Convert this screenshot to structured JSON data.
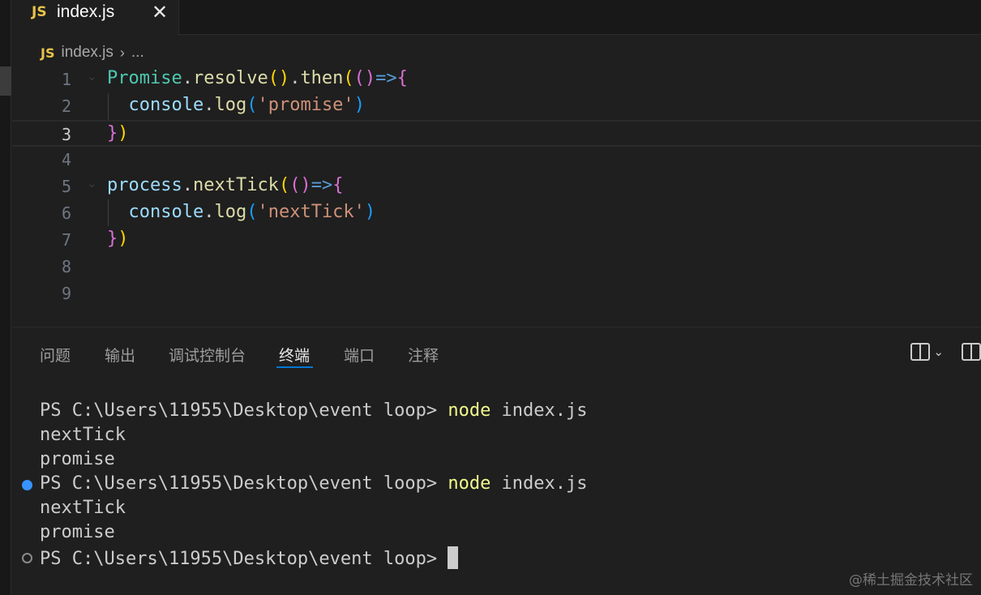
{
  "tab": {
    "badge": "JS",
    "label": "index.js",
    "close": "✕"
  },
  "breadcrumb": {
    "badge": "JS",
    "file": "index.js",
    "separator": "›",
    "more": "..."
  },
  "editor": {
    "lines": [
      {
        "num": "1",
        "tokens": [
          {
            "t": "Promise",
            "c": "tok-obj"
          },
          {
            "t": ".",
            "c": "tok-punct"
          },
          {
            "t": "resolve",
            "c": "tok-fn"
          },
          {
            "t": "()",
            "c": "tok-b1"
          },
          {
            "t": ".",
            "c": "tok-punct"
          },
          {
            "t": "then",
            "c": "tok-fn"
          },
          {
            "t": "(",
            "c": "tok-b1"
          },
          {
            "t": "()",
            "c": "tok-b2"
          },
          {
            "t": "=>",
            "c": "tok-kw"
          },
          {
            "t": "{",
            "c": "tok-b2"
          }
        ]
      },
      {
        "num": "2",
        "tokens": [
          {
            "t": "  console",
            "c": "tok-var"
          },
          {
            "t": ".",
            "c": "tok-punct"
          },
          {
            "t": "log",
            "c": "tok-fn"
          },
          {
            "t": "(",
            "c": "tok-b3"
          },
          {
            "t": "'promise'",
            "c": "tok-str"
          },
          {
            "t": ")",
            "c": "tok-b3"
          }
        ]
      },
      {
        "num": "3",
        "tokens": [
          {
            "t": "}",
            "c": "tok-b2"
          },
          {
            "t": ")",
            "c": "tok-b1"
          }
        ]
      },
      {
        "num": "4",
        "tokens": []
      },
      {
        "num": "5",
        "tokens": [
          {
            "t": "process",
            "c": "tok-var"
          },
          {
            "t": ".",
            "c": "tok-punct"
          },
          {
            "t": "nextTick",
            "c": "tok-fn"
          },
          {
            "t": "(",
            "c": "tok-b1"
          },
          {
            "t": "()",
            "c": "tok-b2"
          },
          {
            "t": "=>",
            "c": "tok-kw"
          },
          {
            "t": "{",
            "c": "tok-b2"
          }
        ]
      },
      {
        "num": "6",
        "tokens": [
          {
            "t": "  console",
            "c": "tok-var"
          },
          {
            "t": ".",
            "c": "tok-punct"
          },
          {
            "t": "log",
            "c": "tok-fn"
          },
          {
            "t": "(",
            "c": "tok-b3"
          },
          {
            "t": "'nextTick'",
            "c": "tok-str"
          },
          {
            "t": ")",
            "c": "tok-b3"
          }
        ]
      },
      {
        "num": "7",
        "tokens": [
          {
            "t": "}",
            "c": "tok-b2"
          },
          {
            "t": ")",
            "c": "tok-b1"
          }
        ]
      },
      {
        "num": "8",
        "tokens": []
      },
      {
        "num": "9",
        "tokens": []
      }
    ]
  },
  "panel": {
    "tabs": [
      "问题",
      "输出",
      "调试控制台",
      "终端",
      "端口",
      "注释"
    ],
    "active_tab": "终端"
  },
  "terminal": {
    "prompt": "PS C:\\Users\\11955\\Desktop\\event loop> ",
    "command": "node",
    "args": " index.js",
    "output_1": "nextTick",
    "output_2": "promise"
  },
  "watermark": "@稀土掘金技术社区",
  "colors": {
    "accent": "#0078d4",
    "success_dot": "#3794ff"
  }
}
